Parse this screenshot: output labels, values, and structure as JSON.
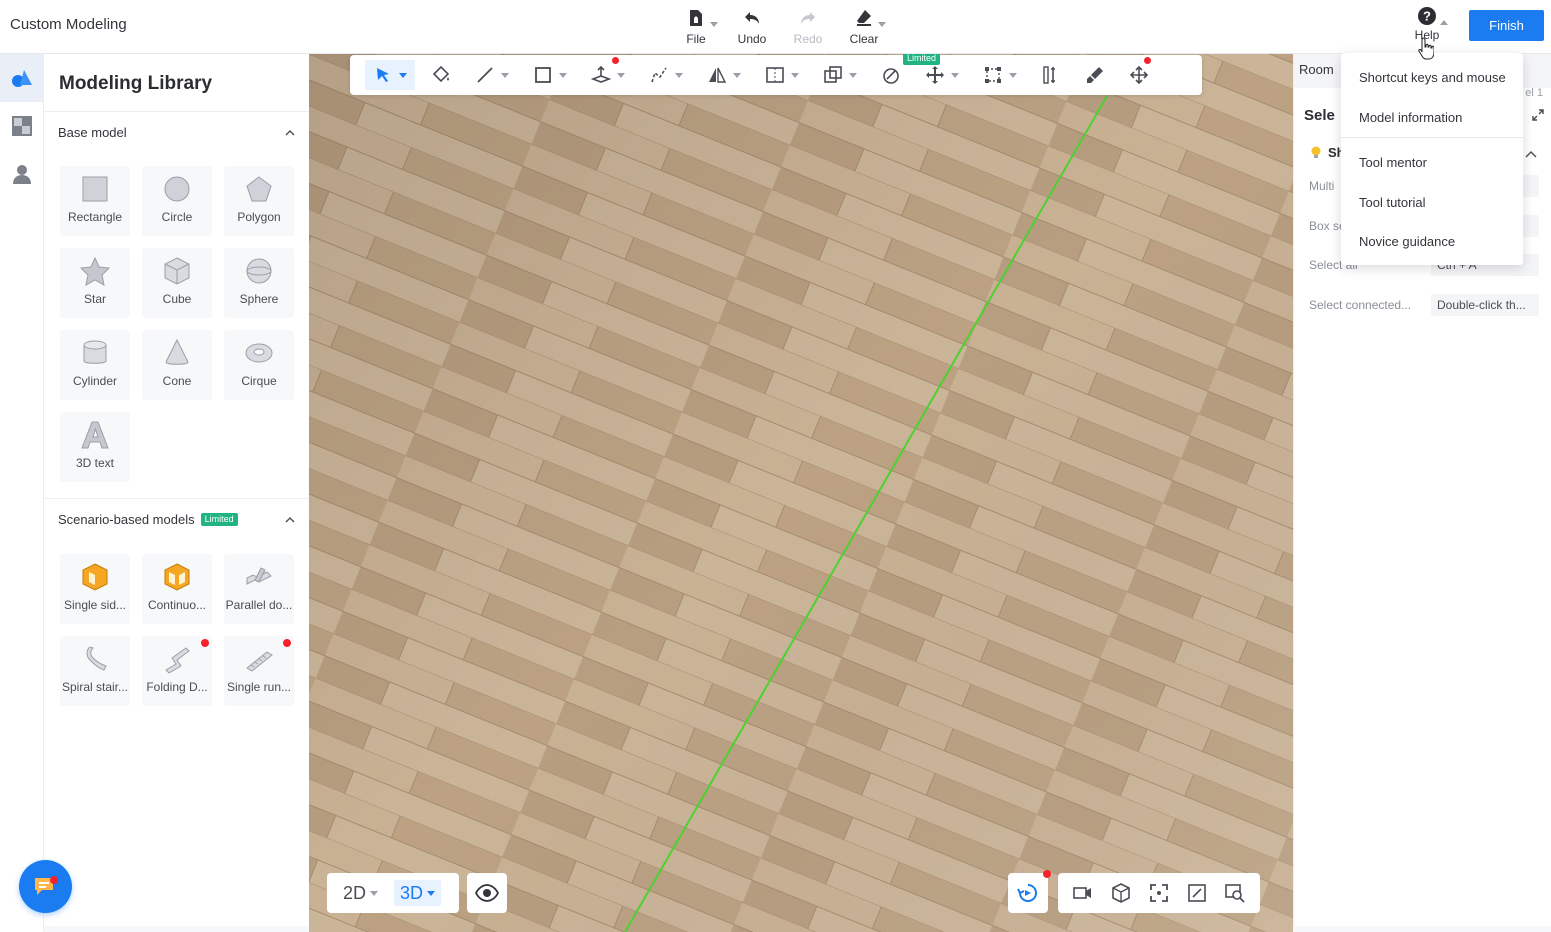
{
  "app": {
    "title": "Custom Modeling"
  },
  "top_tools": [
    {
      "label": "File",
      "icon": "file-icon",
      "has_caret": true,
      "disabled": false
    },
    {
      "label": "Undo",
      "icon": "undo-icon",
      "has_caret": false,
      "disabled": false
    },
    {
      "label": "Redo",
      "icon": "redo-icon",
      "has_caret": false,
      "disabled": true
    },
    {
      "label": "Clear",
      "icon": "eraser-icon",
      "has_caret": true,
      "disabled": false
    }
  ],
  "help": {
    "label": "Help",
    "icon": "question-icon"
  },
  "finish_label": "Finish",
  "library": {
    "title": "Modeling Library",
    "base_section": {
      "label": "Base model",
      "items": [
        {
          "label": "Rectangle",
          "icon": "rectangle-icon"
        },
        {
          "label": "Circle",
          "icon": "circle-icon"
        },
        {
          "label": "Polygon",
          "icon": "polygon-icon"
        },
        {
          "label": "Star",
          "icon": "star-icon"
        },
        {
          "label": "Cube",
          "icon": "cube-icon"
        },
        {
          "label": "Sphere",
          "icon": "sphere-icon"
        },
        {
          "label": "Cylinder",
          "icon": "cylinder-icon"
        },
        {
          "label": "Cone",
          "icon": "cone-icon"
        },
        {
          "label": "Cirque",
          "icon": "torus-icon"
        },
        {
          "label": "3D text",
          "icon": "text-3d-icon"
        }
      ]
    },
    "scenario_section": {
      "label": "Scenario-based models",
      "tag": "Limited",
      "items": [
        {
          "label": "Single sid...",
          "icon": "single-side-icon",
          "badge": false
        },
        {
          "label": "Continuo...",
          "icon": "continuous-icon",
          "badge": false
        },
        {
          "label": "Parallel do...",
          "icon": "parallel-stair-icon",
          "badge": false
        },
        {
          "label": "Spiral stair...",
          "icon": "spiral-stair-icon",
          "badge": false
        },
        {
          "label": "Folding D...",
          "icon": "folding-stair-icon",
          "badge": true
        },
        {
          "label": "Single run...",
          "icon": "single-run-stair-icon",
          "badge": true
        }
      ]
    }
  },
  "toolbar": {
    "limited_tag": "Limited"
  },
  "view": {
    "mode_2d": "2D",
    "mode_3d": "3D",
    "active_mode": "3D"
  },
  "right_panel": {
    "tab": "Room",
    "small": "el 1",
    "title": "Sele",
    "section": "Sh",
    "rows": [
      {
        "key": "Multi",
        "value": "..."
      },
      {
        "key": "Box se",
        "value": "..."
      },
      {
        "key": "Select all",
        "value": "Ctrl + A"
      },
      {
        "key": "Select connected...",
        "value": "Double-click th..."
      }
    ]
  },
  "help_menu": {
    "items": [
      "Shortcut keys and mouse",
      "Model information",
      "Tool mentor",
      "Tool tutorial",
      "Novice guidance"
    ]
  },
  "colors": {
    "accent": "#1a7cf0",
    "limited_tag": "#20b383",
    "badge": "#f5222d",
    "floor": "#c2a98a",
    "axis_line": "#4cd12e"
  }
}
